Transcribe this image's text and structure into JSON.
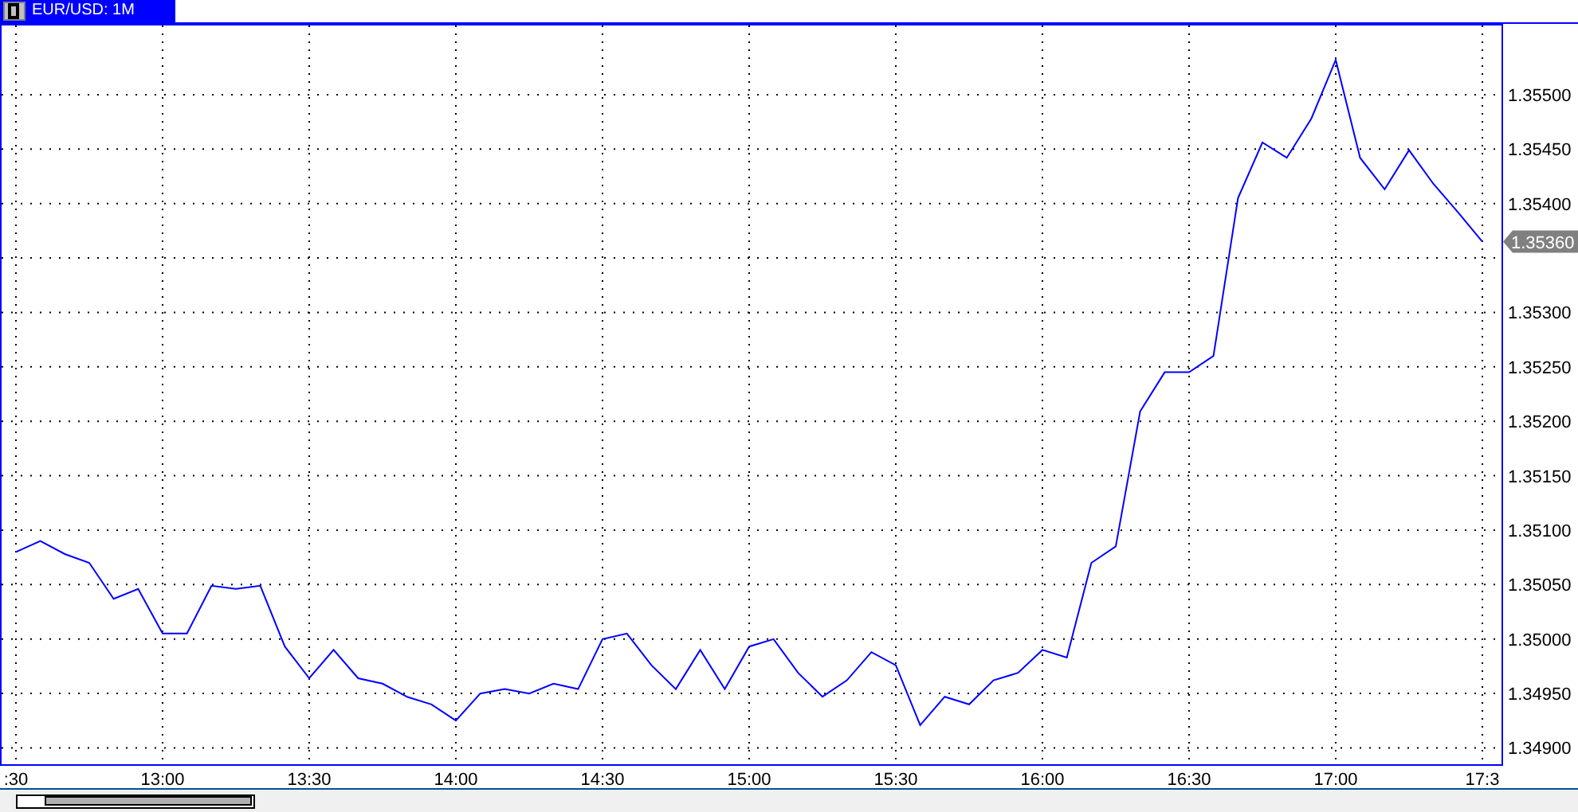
{
  "tab": {
    "title": "EUR/USD: 1M",
    "selected": true
  },
  "chart": {
    "price_tag": "1.35360",
    "chart_data": {
      "type": "line",
      "categories": [
        ":30",
        null,
        null,
        null,
        null,
        null,
        "13:00",
        null,
        null,
        null,
        null,
        null,
        "13:30",
        null,
        null,
        null,
        null,
        null,
        "14:00",
        null,
        null,
        null,
        null,
        null,
        "14:30",
        null,
        null,
        null,
        null,
        null,
        "15:00",
        null,
        null,
        null,
        null,
        null,
        "15:30",
        null,
        null,
        null,
        null,
        null,
        "16:00",
        null,
        null,
        null,
        null,
        null,
        "16:30",
        null,
        null,
        null,
        null,
        null,
        "17:00",
        null,
        null,
        null,
        null,
        null,
        "17:3"
      ],
      "series": [
        {
          "color": "#0000ff",
          "values": [
            1.3508,
            1.3509,
            1.35078,
            1.3507,
            1.35037,
            1.35046,
            1.35005,
            1.35005,
            1.35049,
            1.35046,
            1.35049,
            1.34993,
            1.34964,
            1.3499,
            1.34964,
            1.34959,
            1.34947,
            1.3494,
            1.34925,
            1.3495,
            1.34954,
            1.3495,
            1.34959,
            1.34954,
            1.35,
            1.35005,
            1.34976,
            1.34954,
            1.3499,
            1.34954,
            1.34993,
            1.35,
            1.34969,
            1.34947,
            1.34962,
            1.34988,
            1.34976,
            1.34921,
            1.34947,
            1.3494,
            1.34962,
            1.34969,
            1.3499,
            1.34983,
            1.3507,
            1.35085,
            1.35209,
            1.35245,
            1.35245,
            1.3526,
            1.35405,
            1.35456,
            1.35442,
            1.35478,
            1.35532,
            1.35442,
            1.35413,
            1.35449,
            1.35418,
            1.35392,
            1.35365
          ]
        }
      ],
      "grid": true,
      "ylim": [
        1.34885,
        1.35565
      ],
      "yticks": [
        {
          "value": 1.349,
          "label": "1.34900"
        },
        {
          "value": 1.3495,
          "label": "1.34950"
        },
        {
          "value": 1.35,
          "label": "1.35000"
        },
        {
          "value": 1.3505,
          "label": "1.35050"
        },
        {
          "value": 1.351,
          "label": "1.35100"
        },
        {
          "value": 1.3515,
          "label": "1.35150"
        },
        {
          "value": 1.352,
          "label": "1.35200"
        },
        {
          "value": 1.3525,
          "label": "1.35250"
        },
        {
          "value": 1.353,
          "label": "1.35300"
        },
        {
          "value": 1.354,
          "label": "1.35400"
        },
        {
          "value": 1.3545,
          "label": "1.35450"
        },
        {
          "value": 1.355,
          "label": "1.35500"
        }
      ]
    }
  }
}
